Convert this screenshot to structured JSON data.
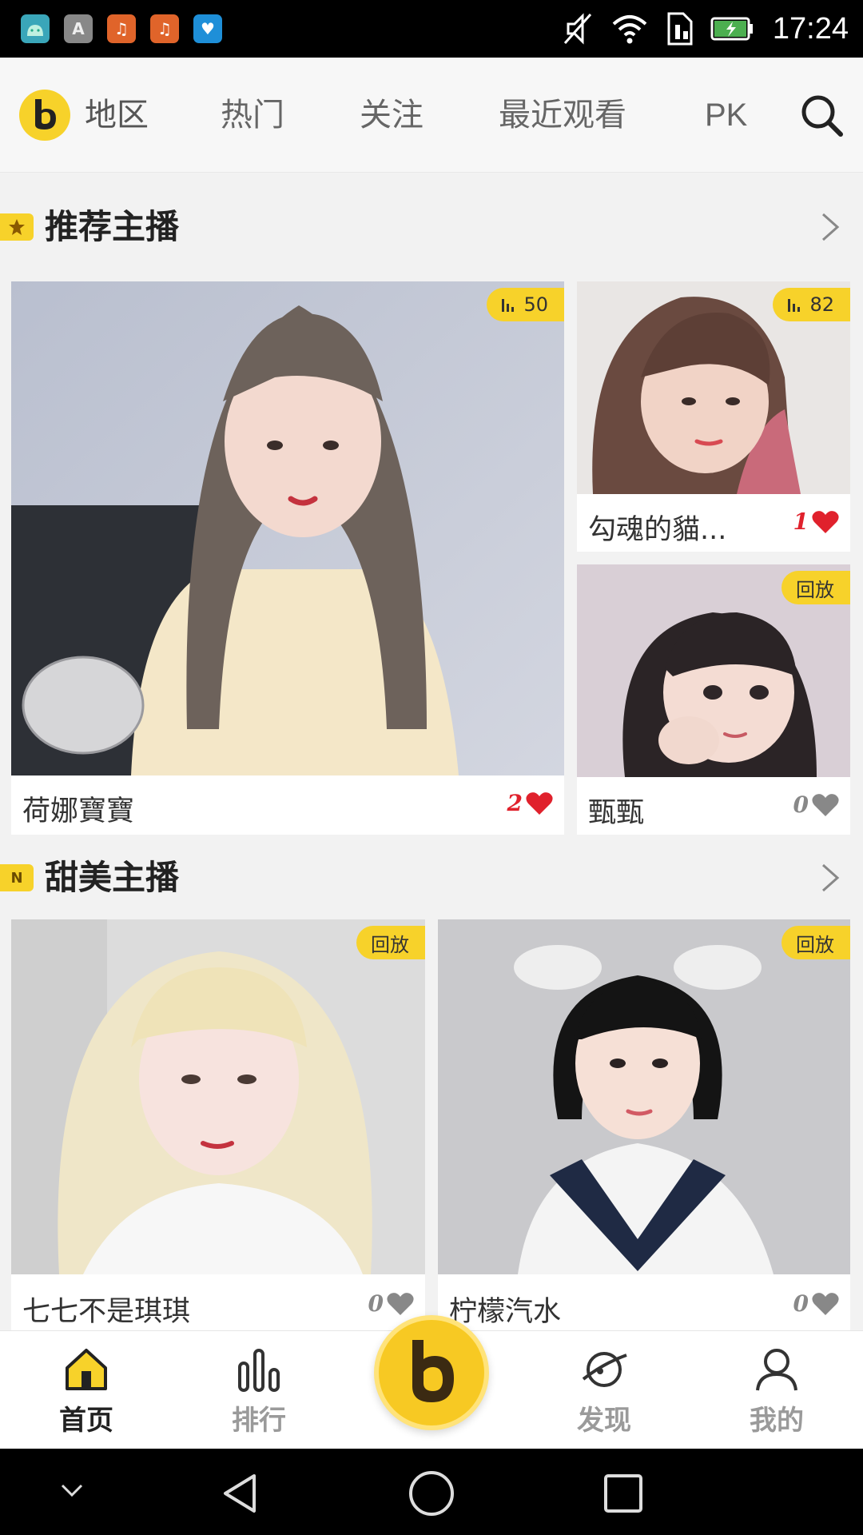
{
  "status_bar": {
    "time": "17:24",
    "app_icons": [
      "android-icon",
      "font-a-icon",
      "music-icon",
      "music-icon",
      "heart-app-icon"
    ],
    "system_icons": [
      "mute-icon",
      "wifi-icon",
      "sim-icon",
      "battery-charging-icon"
    ]
  },
  "top_nav": {
    "logo_icon": "b-logo-icon",
    "items": [
      "地区",
      "热门",
      "关注",
      "最近观看",
      "PK"
    ],
    "search_icon": "search-icon"
  },
  "sections": [
    {
      "title": "推荐主播",
      "badge": "star",
      "badge_text": ""
    },
    {
      "title": "甜美主播",
      "badge": "new",
      "badge_text": "N"
    }
  ],
  "recommended": [
    {
      "name": "荷娜寶寶",
      "likes": "2",
      "viewers": "50",
      "badge": ""
    },
    {
      "name": "勾魂的貓...",
      "likes": "1",
      "viewers": "82",
      "badge": ""
    },
    {
      "name": "甄甄",
      "likes": "0",
      "viewers": "",
      "badge": "回放"
    }
  ],
  "sweet": [
    {
      "name": "七七不是琪琪",
      "likes": "0",
      "badge": "回放"
    },
    {
      "name": "柠檬汽水",
      "likes": "0",
      "badge": "回放"
    }
  ],
  "bottom_nav": {
    "tabs": [
      {
        "label": "首页",
        "icon": "home-icon",
        "active": true
      },
      {
        "label": "排行",
        "icon": "ranking-icon",
        "active": false
      },
      {
        "label": "发现",
        "icon": "planet-icon",
        "active": false
      },
      {
        "label": "我的",
        "icon": "profile-icon",
        "active": false
      }
    ],
    "center_icon": "b-logo-icon"
  },
  "colors": {
    "accent": "#f7d22a",
    "heart_red": "#e0212c",
    "heart_grey": "#888888"
  }
}
